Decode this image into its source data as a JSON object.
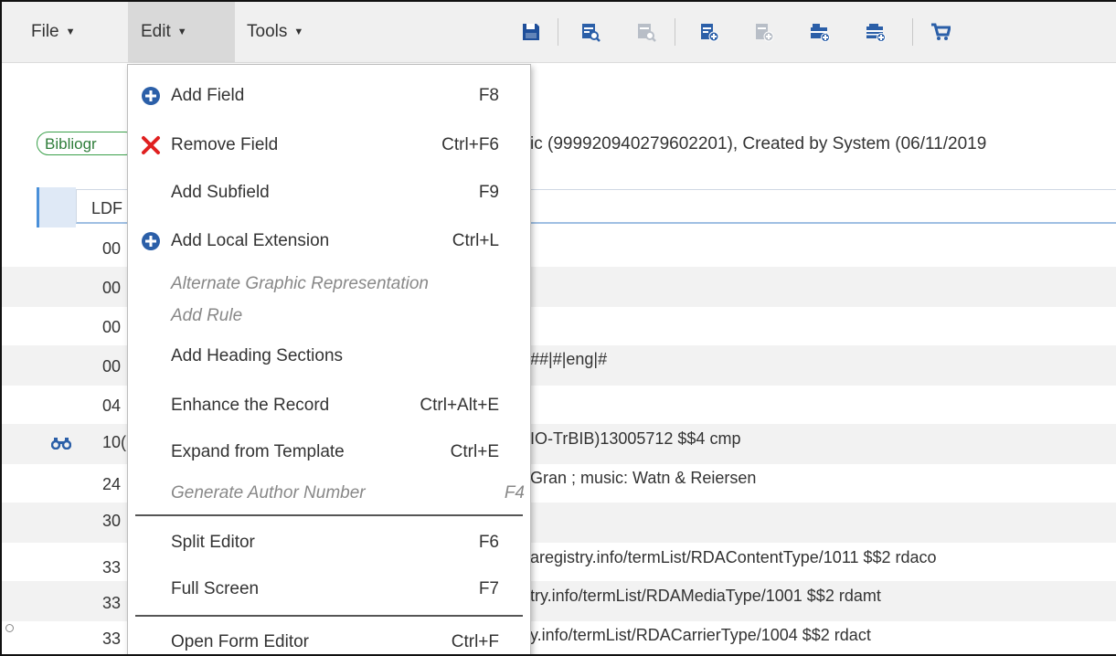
{
  "menubar": {
    "file": "File",
    "edit": "Edit",
    "tools": "Tools",
    "icons": [
      "save-icon",
      "search-record-icon",
      "search-record-disabled-icon",
      "add-record-icon",
      "add-record-disabled-icon",
      "add-inventory-icon",
      "add-inventory-alt-icon",
      "cart-icon"
    ]
  },
  "record": {
    "badge": "Bibliogr",
    "info": "ic (999920940279602201), Created by System (06/11/2019",
    "ldr_label": "LDF",
    "rows": [
      {
        "tag": "00",
        "value": ""
      },
      {
        "tag": "00",
        "value": ""
      },
      {
        "tag": "00",
        "value": ""
      },
      {
        "tag": "00",
        "value": "##|#|eng|#"
      },
      {
        "tag": "04",
        "value": ""
      },
      {
        "tag": "10(",
        "value": "IO-TrBIB)13005712 $$4 cmp"
      },
      {
        "tag": "24",
        "value": "Gran ; music: Watn & Reiersen"
      },
      {
        "tag": "30",
        "value": ""
      },
      {
        "tag": "33",
        "value": "aregistry.info/termList/RDAContentType/1011 $$2 rdaco"
      },
      {
        "tag": "33",
        "value": "try.info/termList/RDAMediaType/1001 $$2 rdamt"
      },
      {
        "tag": "33",
        "value": "y.info/termList/RDACarrierType/1004 $$2 rdact"
      }
    ]
  },
  "edit_menu": {
    "items": [
      {
        "label": "Add Field",
        "shortcut": "F8",
        "icon": "plus-circle-icon",
        "disabled": false
      },
      {
        "label": "Remove Field",
        "shortcut": "Ctrl+F6",
        "icon": "red-x-icon",
        "disabled": false
      },
      {
        "label": "Add Subfield",
        "shortcut": "F9",
        "icon": "",
        "disabled": false
      },
      {
        "label": "Add Local Extension",
        "shortcut": "Ctrl+L",
        "icon": "plus-circle-icon",
        "disabled": false
      },
      {
        "label": "Alternate Graphic Representation",
        "shortcut": "",
        "icon": "",
        "disabled": true
      },
      {
        "label": "Add Rule",
        "shortcut": "",
        "icon": "",
        "disabled": true
      },
      {
        "label": "Add Heading Sections",
        "shortcut": "",
        "icon": "",
        "disabled": false
      },
      {
        "label": "Enhance the Record",
        "shortcut": "Ctrl+Alt+E",
        "icon": "",
        "disabled": false
      },
      {
        "label": "Expand from Template",
        "shortcut": "Ctrl+E",
        "icon": "",
        "disabled": false
      },
      {
        "label": "Generate Author Number",
        "shortcut": "F4",
        "icon": "",
        "disabled": true
      },
      {
        "label": "Split Editor",
        "shortcut": "F6",
        "icon": "",
        "disabled": false
      },
      {
        "label": "Full Screen",
        "shortcut": "F7",
        "icon": "",
        "disabled": false
      },
      {
        "label": "Open Form Editor",
        "shortcut": "Ctrl+F",
        "icon": "",
        "disabled": false
      }
    ]
  },
  "colors": {
    "accent_blue": "#2b5fa8",
    "remove_red": "#e02020",
    "badge_green": "#3aa04a"
  }
}
